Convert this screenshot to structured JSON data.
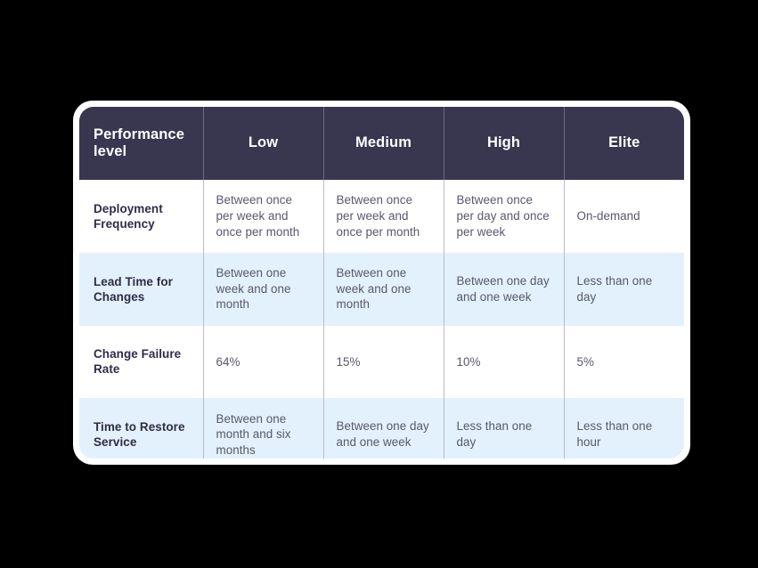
{
  "card": {
    "accent_dark": "#393650",
    "row_shade": "#e3f1fc",
    "row_plain": "#ffffff",
    "label_text_color": "#2f2c47",
    "cell_text_color": "#57586b",
    "divider_color": "#b9bcc6",
    "background": "#000000"
  },
  "table": {
    "headers": [
      "Performance level",
      "Low",
      "Medium",
      "High",
      "Elite"
    ],
    "rows": [
      {
        "label": "Deployment Frequency",
        "shaded": false,
        "cells": [
          "Between once per week and once per month",
          "Between once per week and once per month",
          "Between once per day and once per week",
          "On-demand"
        ]
      },
      {
        "label": "Lead Time for Changes",
        "shaded": true,
        "cells": [
          "Between one week and one month",
          "Between one week and one month",
          "Between one day and one week",
          "Less than one day"
        ]
      },
      {
        "label": "Change Failure Rate",
        "shaded": false,
        "cells": [
          "64%",
          "15%",
          "10%",
          "5%"
        ]
      },
      {
        "label": "Time to Restore Service",
        "shaded": true,
        "cells": [
          "Between one month and six months",
          "Between one day and one week",
          "Less than one day",
          "Less than one hour"
        ]
      }
    ]
  }
}
